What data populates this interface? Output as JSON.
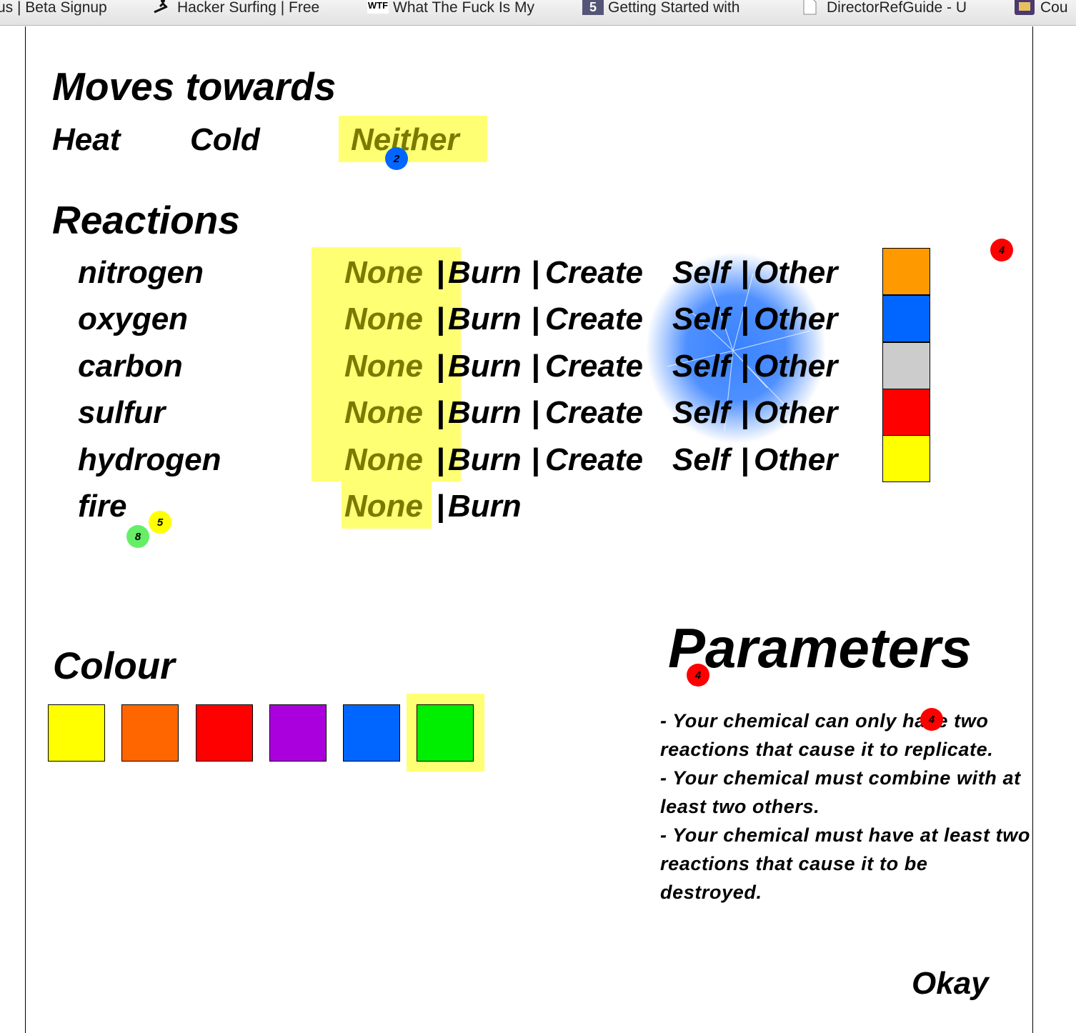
{
  "bookmarks": [
    {
      "label": "us | Beta Signup"
    },
    {
      "label": "Hacker Surfing | Free",
      "icon": "surfer-icon"
    },
    {
      "label": "What The Fuck Is My",
      "icon": "wtf-icon"
    },
    {
      "label": "Getting Started with",
      "icon": "html5-icon"
    },
    {
      "label": "DirectorRefGuide - U",
      "icon": "page-icon"
    },
    {
      "label": "Cou",
      "icon": "app-icon"
    }
  ],
  "moves": {
    "title": "Moves towards",
    "options": [
      "Heat",
      "Cold",
      "Neither"
    ],
    "selected": "Neither"
  },
  "reactions": {
    "title": "Reactions",
    "rows": [
      {
        "element": "nitrogen",
        "none": "None",
        "burn": "Burn",
        "create": "Create",
        "self": "Self",
        "other": "Other",
        "color": "#ff9900"
      },
      {
        "element": "oxygen",
        "none": "None",
        "burn": "Burn",
        "create": "Create",
        "self": "Self",
        "other": "Other",
        "color": "#0066ff"
      },
      {
        "element": "carbon",
        "none": "None",
        "burn": "Burn",
        "create": "Create",
        "self": "Self",
        "other": "Other",
        "color": "#cccccc"
      },
      {
        "element": "sulfur",
        "none": "None",
        "burn": "Burn",
        "create": "Create",
        "self": "Self",
        "other": "Other",
        "color": "#ff0000"
      },
      {
        "element": "hydrogen",
        "none": "None",
        "burn": "Burn",
        "create": "Create",
        "self": "Self",
        "other": "Other",
        "color": "#ffff00"
      },
      {
        "element": "fire",
        "none": "None",
        "burn": "Burn"
      }
    ],
    "separator": "|"
  },
  "colour": {
    "title": "Colour",
    "swatches": [
      "#ffff00",
      "#ff6600",
      "#ff0000",
      "#aa00dd",
      "#0066ff",
      "#00ee00"
    ],
    "selected_index": 5
  },
  "parameters": {
    "title": "Parameters",
    "rules": [
      "- Your chemical can only have two reactions that cause it to replicate.",
      "- Your chemical must combine with at least two others.",
      "- Your chemical must have at least two reactions that cause it to be destroyed."
    ],
    "okay_label": "Okay"
  },
  "particles": [
    {
      "label": "2",
      "color": "#0066ff"
    },
    {
      "label": "4",
      "color": "#ff0000"
    },
    {
      "label": "5",
      "color": "#ffff00"
    },
    {
      "label": "8",
      "color": "#66ee66"
    },
    {
      "label": "4",
      "color": "#ff0000"
    },
    {
      "label": "4",
      "color": "#ff0000"
    }
  ]
}
